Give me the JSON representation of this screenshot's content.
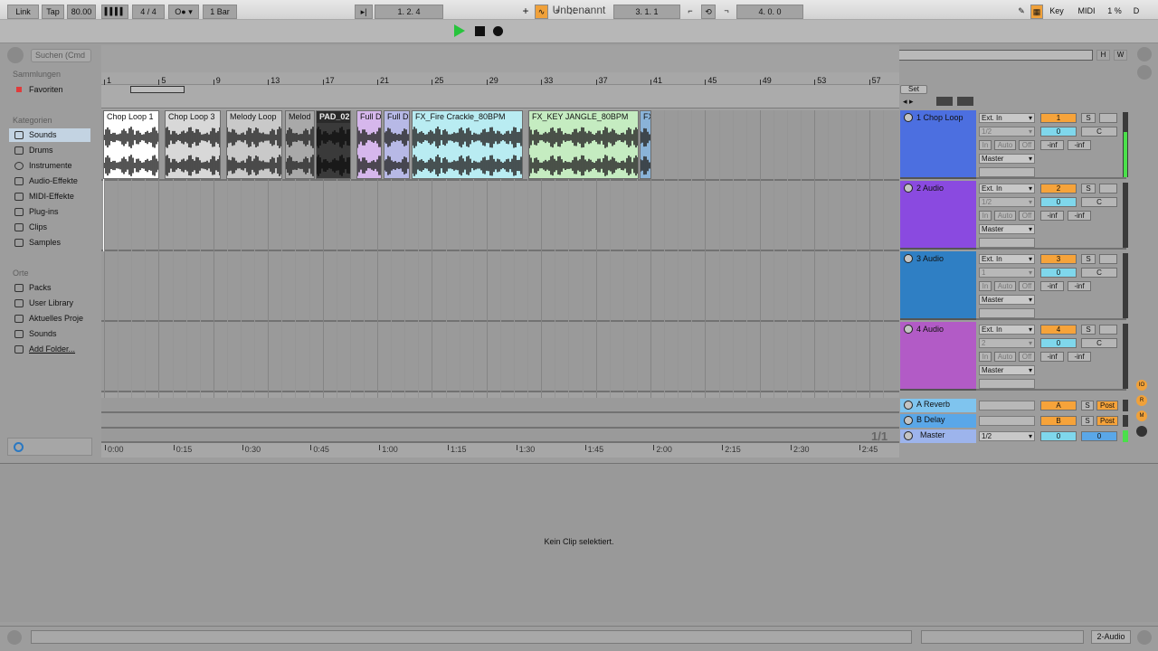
{
  "window": {
    "title": "Unbenannt"
  },
  "control": {
    "link": "Link",
    "tap": "Tap",
    "tempo": "80.00",
    "signature": "4 / 4",
    "quantize": "1 Bar",
    "position": "1.   2.   4",
    "loop_start": "3.   1.   1",
    "loop_length": "4.   0.   0",
    "key": "Key",
    "midi": "MIDI",
    "cpu": "1 %",
    "d": "D"
  },
  "browser": {
    "search_placeholder": "Suchen (Cmd",
    "collections_title": "Sammlungen",
    "favorites": "Favoriten",
    "categories_title": "Kategorien",
    "categories": [
      "Sounds",
      "Drums",
      "Instrumente",
      "Audio-Effekte",
      "MIDI-Effekte",
      "Plug-ins",
      "Clips",
      "Samples"
    ],
    "places_title": "Orte",
    "places": [
      "Packs",
      "User Library",
      "Aktuelles Proje",
      "Sounds",
      "Add Folder..."
    ]
  },
  "ruler": {
    "bars": [
      "1",
      "5",
      "9",
      "13",
      "17",
      "21",
      "25",
      "29",
      "33",
      "37",
      "41",
      "45",
      "49",
      "53",
      "57"
    ],
    "times": [
      "0:00",
      "0:15",
      "0:30",
      "0:45",
      "1:00",
      "1:15",
      "1:30",
      "1:45",
      "2:00",
      "2:15",
      "2:30",
      "2:45"
    ],
    "page": "1/1"
  },
  "clips": [
    {
      "name": "Chop Loop 1",
      "color": "#ffffff"
    },
    {
      "name": "Chop Loop 3",
      "color": "#d8d8d8"
    },
    {
      "name": "Melody Loop",
      "color": "#c9c9c9"
    },
    {
      "name": "Melod",
      "color": "#a9a9a9"
    },
    {
      "name": "PAD_02",
      "color": "#3a3a3a"
    },
    {
      "name": "Full D",
      "color": "#d6b7ec"
    },
    {
      "name": "Full D",
      "color": "#b7b9e6"
    },
    {
      "name": "FX_Fire Crackle_80BPM",
      "color": "#b9ecf2"
    },
    {
      "name": "FX_KEY JANGLE_80BPM",
      "color": "#c5ecc1"
    },
    {
      "name": "FX",
      "color": "#8ab3d8"
    }
  ],
  "mixer": {
    "set": "Set",
    "tracks": [
      {
        "name": "1 Chop Loop",
        "color": "#4c6fe0",
        "input": "Ext. In",
        "channel": "1/2",
        "out": "Master",
        "num": "1",
        "vol": "0",
        "pan": "C",
        "in": "In",
        "auto": "Auto",
        "off": "Off",
        "inf1": "-inf",
        "inf2": "-inf",
        "solo": "S"
      },
      {
        "name": "2 Audio",
        "color": "#8a4ae0",
        "input": "Ext. In",
        "channel": "1/2",
        "out": "Master",
        "num": "2",
        "vol": "0",
        "pan": "C",
        "in": "In",
        "auto": "Auto",
        "off": "Off",
        "inf1": "-inf",
        "inf2": "-inf",
        "solo": "S"
      },
      {
        "name": "3 Audio",
        "color": "#2f7fc4",
        "input": "Ext. In",
        "channel": "1",
        "out": "Master",
        "num": "3",
        "vol": "0",
        "pan": "C",
        "in": "In",
        "auto": "Auto",
        "off": "Off",
        "inf1": "-inf",
        "inf2": "-inf",
        "solo": "S"
      },
      {
        "name": "4 Audio",
        "color": "#b25bc6",
        "input": "Ext. In",
        "channel": "2",
        "out": "Master",
        "num": "4",
        "vol": "0",
        "pan": "C",
        "in": "In",
        "auto": "Auto",
        "off": "Off",
        "inf1": "-inf",
        "inf2": "-inf",
        "solo": "S"
      }
    ],
    "returns": [
      {
        "name": "A Reverb",
        "color": "#7fc4ee",
        "letter": "A",
        "solo": "S",
        "post": "Post"
      },
      {
        "name": "B Delay",
        "color": "#5aa7e8",
        "letter": "B",
        "solo": "S",
        "post": "Post"
      }
    ],
    "master": {
      "name": "Master",
      "color": "#9db4ec",
      "channel": "1/2",
      "vol": "0",
      "pan": "0"
    },
    "side": {
      "io": "IO",
      "r": "R",
      "m": "M"
    }
  },
  "detail": {
    "message": "Kein Clip selektiert."
  },
  "status": {
    "track": "2-Audio"
  }
}
